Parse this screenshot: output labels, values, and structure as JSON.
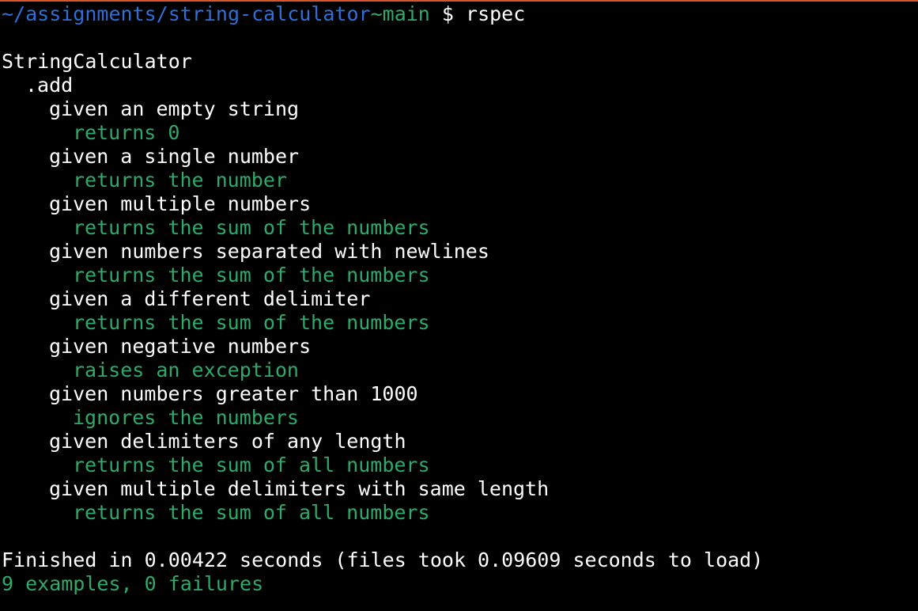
{
  "colors": {
    "top_border": "#d9532b",
    "background": "#000000",
    "path": "#2f6fd8",
    "branch": "#2eaa6a",
    "pass": "#2eaa6a",
    "text": "#ffffff"
  },
  "prompt": {
    "path": "~/assignments/string-calculator",
    "branch": "~main",
    "symbol": " $ ",
    "command": "rspec"
  },
  "spec": {
    "describe": "StringCalculator",
    "method": ".add",
    "contexts": [
      {
        "context": "given an empty string",
        "example": "returns 0"
      },
      {
        "context": "given a single number",
        "example": "returns the number"
      },
      {
        "context": "given multiple numbers",
        "example": "returns the sum of the numbers"
      },
      {
        "context": "given numbers separated with newlines",
        "example": "returns the sum of the numbers"
      },
      {
        "context": "given a different delimiter",
        "example": "returns the sum of the numbers"
      },
      {
        "context": "given negative numbers",
        "example": "raises an exception"
      },
      {
        "context": "given numbers greater than 1000",
        "example": "ignores the numbers"
      },
      {
        "context": "given delimiters of any length",
        "example": "returns the sum of all numbers"
      },
      {
        "context": "given multiple delimiters with same length",
        "example": "returns the sum of all numbers"
      }
    ]
  },
  "summary": {
    "finished": "Finished in 0.00422 seconds (files took 0.09609 seconds to load)",
    "result": "9 examples, 0 failures"
  }
}
